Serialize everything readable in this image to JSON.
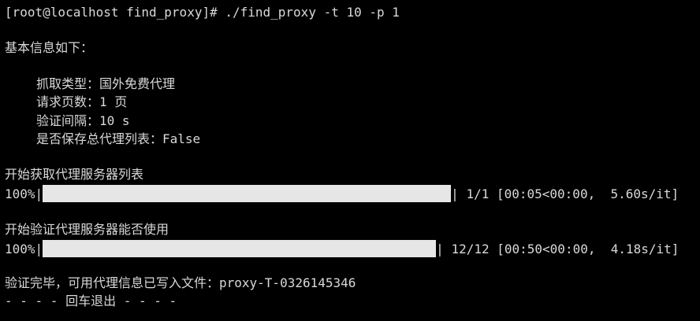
{
  "terminal": {
    "command": "[root@localhost find_proxy]# ./find_proxy -t 10 -p 1",
    "info_header": "基本信息如下：",
    "info_items": [
      "抓取类型：国外免费代理",
      "请求页数：1 页",
      "验证间隔：10 s",
      "是否保存总代理列表：False"
    ],
    "task1_title": "开始获取代理服务器列表",
    "task1_progress": {
      "percent_label": "100%|",
      "percent": 100,
      "right_edge": "|",
      "stats": " 1/1 [00:05<00:00,  5.60s/it]"
    },
    "task2_title": "开始验证代理服务器能否使用",
    "task2_progress": {
      "percent_label": "100%|",
      "percent": 100,
      "right_edge": "|",
      "stats": " 12/12 [00:50<00:00,  4.18s/it]"
    },
    "result": "验证完毕，可用代理信息已写入文件：proxy-T-0326145346",
    "exit_hint": "- - - - 回车退出 - - - -"
  },
  "colors": {
    "background": "#000000",
    "text": "#d9d9d9",
    "bar_fill": "#e6e6e6"
  }
}
